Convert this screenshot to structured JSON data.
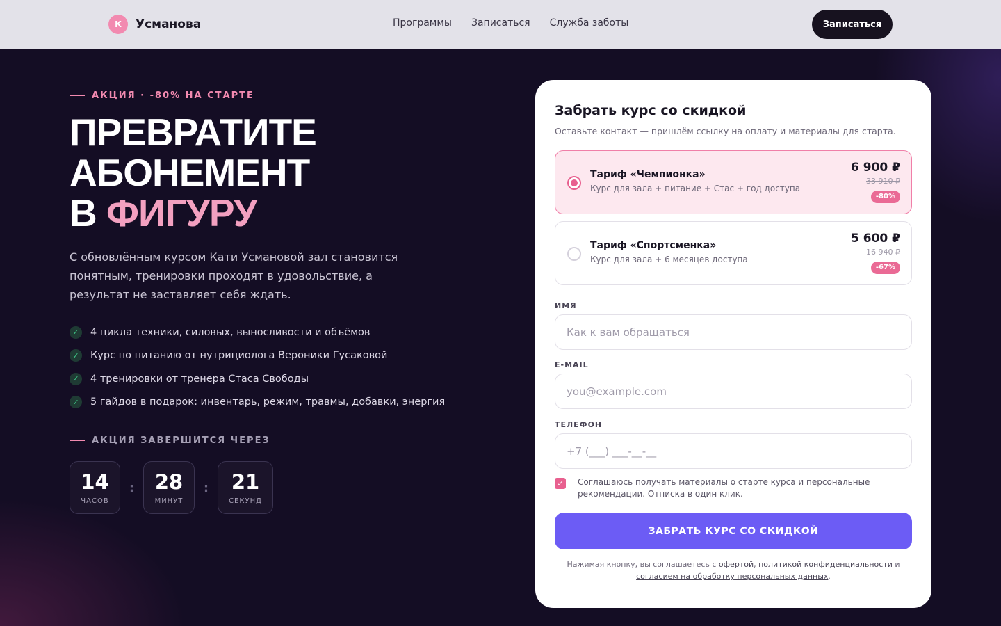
{
  "header": {
    "logo_letter": "К",
    "logo_text": "Усманова",
    "nav": [
      "Программы",
      "Записаться",
      "Служба заботы"
    ],
    "cta_label": "Записаться"
  },
  "hero": {
    "kicker": "АКЦИЯ · -80% НА СТАРТЕ",
    "title_line1": "ПРЕВРАТИТЕ",
    "title_line2": "АБОНЕМЕНТ",
    "title_line3_pre": "В",
    "title_line3_accent": "ФИГУРУ",
    "lead": "С обновлённым курсом Кати Усмановой зал становится понятным, тренировки проходят в удовольствие, а результат не заставляет себя ждать.",
    "features": [
      "4 цикла техники, силовых, выносливости и объёмов",
      "Курс по питанию от нутрициолога Вероники Гусаковой",
      "4 тренировки от тренера Стаса Свободы",
      "5 гайдов в подарок: инвентарь, режим, травмы, добавки, энергия"
    ],
    "timer_label": "АКЦИЯ ЗАВЕРШИТСЯ ЧЕРЕЗ",
    "timer": {
      "hours": "14",
      "hours_label": "ЧАСОВ",
      "minutes": "28",
      "minutes_label": "МИНУТ",
      "seconds": "21",
      "seconds_label": "СЕКУНД",
      "separator": ":"
    }
  },
  "form": {
    "title": "Забрать курс со скидкой",
    "subtitle": "Оставьте контакт — пришлём ссылку на оплату и материалы для старта.",
    "plans": [
      {
        "name": "Тариф «Чемпионка»",
        "desc": "Курс для зала + питание + Стас + год доступа",
        "price": "6 900 ₽",
        "old_price": "33 910 ₽",
        "badge": "-80%",
        "selected": true
      },
      {
        "name": "Тариф «Спортсменка»",
        "desc": "Курс для зала + 6 месяцев доступа",
        "price": "5 600 ₽",
        "old_price": "16 940 ₽",
        "badge": "-67%",
        "selected": false
      }
    ],
    "name_label": "ИМЯ",
    "name_placeholder": "Как к вам обращаться",
    "email_label": "E-MAIL",
    "email_placeholder": "you@example.com",
    "phone_label": "ТЕЛЕФОН",
    "phone_placeholder": "+7 (___) ___-__-__",
    "consent_text": "Соглашаюсь получать материалы о старте курса и персональные рекомендации. Отписка в один клик.",
    "consent_checked": true,
    "submit_label": "ЗАБРАТЬ КУРС СО СКИДКОЙ",
    "legal_pre": "Нажимая кнопку, вы соглашаетесь с",
    "legal_link1": "офертой",
    "legal_sep": ",",
    "legal_link2": "политикой конфиденциальности",
    "legal_and": "и",
    "legal_link3": "согласием на обработку персональных данных",
    "legal_end": "."
  },
  "icons": {
    "check": "check-icon",
    "checkbox": "checkbox-checked-icon"
  },
  "colors": {
    "accent_pink": "#f28ab0",
    "cta_purple": "#6c5cf5",
    "hero_bg": "#140d24"
  }
}
